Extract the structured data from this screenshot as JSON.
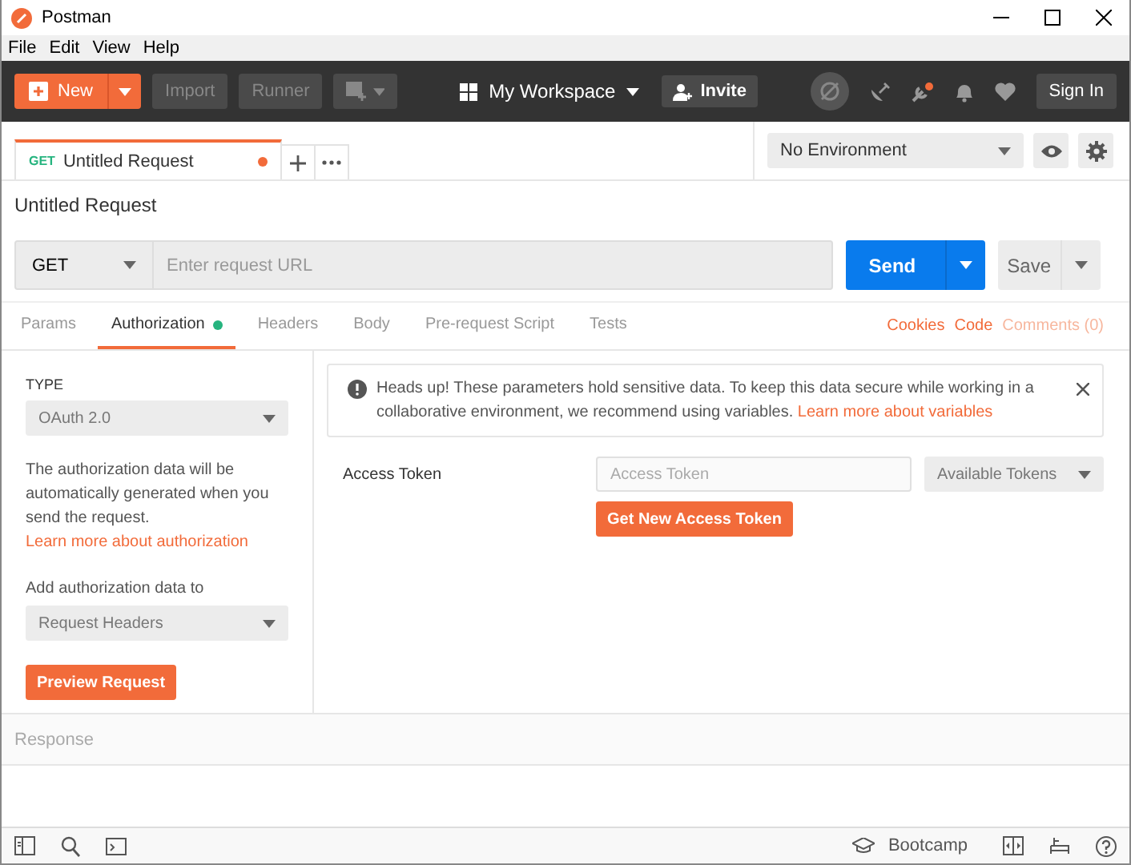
{
  "window": {
    "title": "Postman"
  },
  "menu": [
    "File",
    "Edit",
    "View",
    "Help"
  ],
  "toolbar": {
    "new": "New",
    "import": "Import",
    "runner": "Runner",
    "workspace": "My Workspace",
    "invite": "Invite",
    "sign_in": "Sign In"
  },
  "request_tabs": [
    {
      "method": "GET",
      "title": "Untitled Request",
      "selected": true,
      "unsaved": true
    }
  ],
  "environment": "No Environment",
  "request_name": "Untitled Request",
  "request": {
    "method": "GET",
    "url_placeholder": "Enter request URL",
    "send": "Send",
    "save": "Save"
  },
  "sub_tabs": [
    {
      "label": "Params",
      "selected": false,
      "indicator": false
    },
    {
      "label": "Authorization",
      "selected": true,
      "indicator": true
    },
    {
      "label": "Headers",
      "selected": false,
      "indicator": false
    },
    {
      "label": "Body",
      "selected": false,
      "indicator": false
    },
    {
      "label": "Pre-request Script",
      "selected": false,
      "indicator": false
    },
    {
      "label": "Tests",
      "selected": false,
      "indicator": false
    }
  ],
  "links": [
    {
      "label": "Cookies",
      "disabled": false
    },
    {
      "label": "Code",
      "disabled": false
    },
    {
      "label": "Comments (0)",
      "disabled": true
    }
  ],
  "auth": {
    "type_label": "TYPE",
    "type_value": "OAuth 2.0",
    "description": "The authorization data will be automatically generated when you send the request.",
    "description_link": "Learn more about authorization",
    "add_label": "Add authorization data to",
    "add_value": "Request Headers",
    "preview": "Preview Request"
  },
  "alert": {
    "text": "Heads up! These parameters hold sensitive data. To keep this data secure while working in a collaborative environment, we recommend using variables.",
    "link": "Learn more about variables"
  },
  "access_token": {
    "label": "Access Token",
    "placeholder": "Access Token",
    "dropdown": "Available Tokens",
    "button": "Get New Access Token"
  },
  "response_label": "Response",
  "status_bar": {
    "bootcamp": "Bootcamp"
  }
}
